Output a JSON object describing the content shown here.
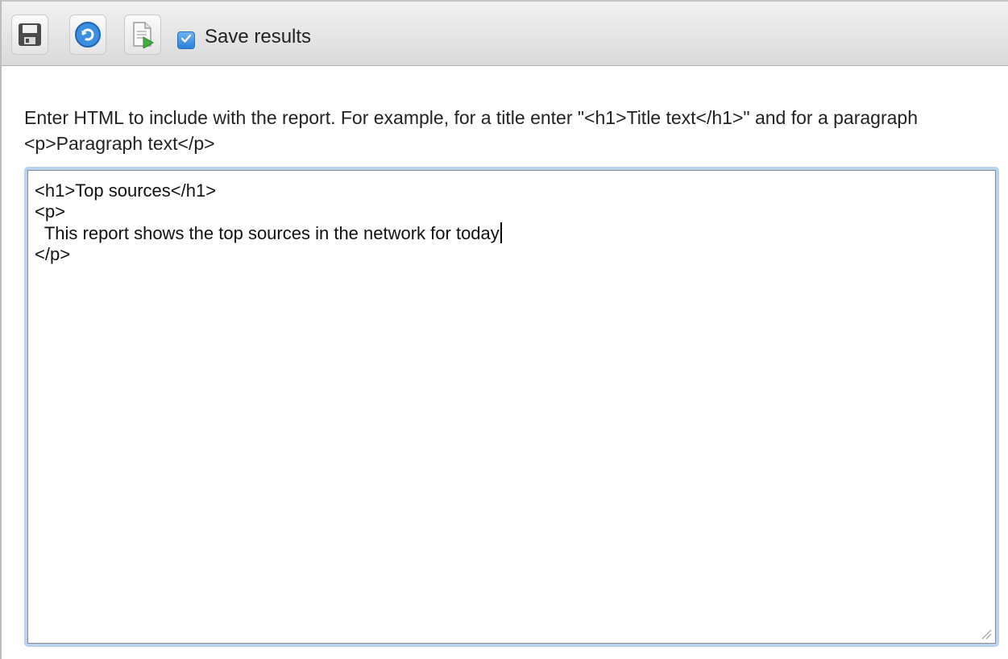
{
  "toolbar": {
    "buttons": [
      {
        "name": "save-icon"
      },
      {
        "name": "refresh-icon"
      },
      {
        "name": "run-report-icon"
      }
    ],
    "save_results_checked": true,
    "save_results_label": "Save results"
  },
  "hint_text": "Enter HTML to include with the report. For example, for a title enter \"<h1>Title text</h1>\" and for a paragraph <p>Paragraph text</p>",
  "editor": {
    "lines": [
      "<h1>Top sources</h1>",
      "<p>",
      "  This report shows the top sources in the network for today",
      "</p>"
    ]
  },
  "colors": {
    "accent": "#2a7fd9",
    "focus_ring": "#b7d3f0"
  }
}
